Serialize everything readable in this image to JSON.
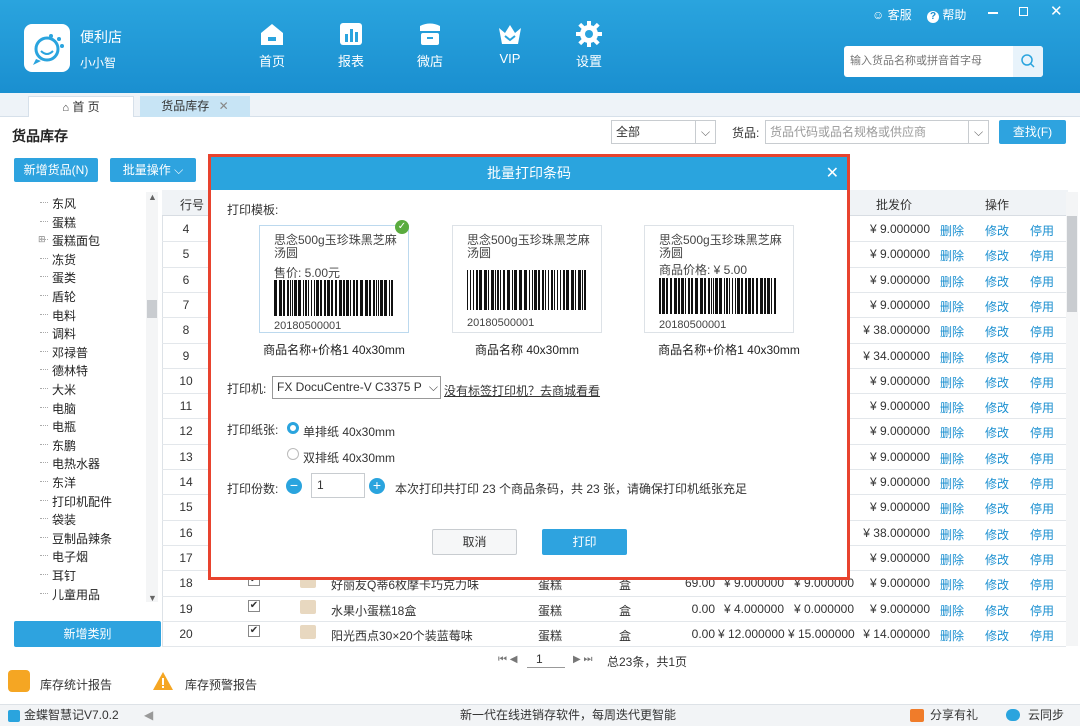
{
  "header": {
    "shop_name": "便利店",
    "user_name": "小小智",
    "nav": [
      {
        "label": "首页",
        "icon": "home-icon"
      },
      {
        "label": "报表",
        "icon": "chart-icon"
      },
      {
        "label": "微店",
        "icon": "store-icon"
      },
      {
        "label": "VIP",
        "icon": "crown-icon"
      },
      {
        "label": "设置",
        "icon": "gear-icon"
      }
    ],
    "service": "客服",
    "help": "帮助",
    "search_placeholder": "输入货品名称或拼音首字母"
  },
  "tabs": [
    {
      "label": "首 页",
      "icon": "home-icon"
    },
    {
      "label": "货品库存",
      "icon": "close-icon"
    }
  ],
  "toolbar": {
    "title": "货品库存",
    "filter_value": "全部",
    "goods_label": "货品:",
    "goods_placeholder": "货品代码或品名规格或供应商",
    "search_btn": "查找(F)",
    "add_goods": "新增货品(N)",
    "batch_ops": "批量操作"
  },
  "tree": {
    "items": [
      "东风",
      "蛋糕",
      "蛋糕面包",
      "冻货",
      "蛋类",
      "盾轮",
      "电料",
      "调料",
      "邓禄普",
      "德林特",
      "大米",
      "电脑",
      "电瓶",
      "东鹏",
      "电热水器",
      "东洋",
      "打印机配件",
      "袋装",
      "豆制品辣条",
      "电子烟",
      "耳钉",
      "儿童用品"
    ],
    "add_category": "新增类别"
  },
  "table": {
    "headers": {
      "row": "行号",
      "wholesale": "批发价",
      "ops": "操作"
    },
    "op_labels": [
      "删除",
      "修改",
      "停用"
    ],
    "visible_rows": [
      {
        "no": "4",
        "price": "¥ 9.000000"
      },
      {
        "no": "5",
        "price": "¥ 9.000000"
      },
      {
        "no": "6",
        "price": "¥ 9.000000"
      },
      {
        "no": "7",
        "price": "¥ 9.000000"
      },
      {
        "no": "8",
        "price": "¥ 38.000000"
      },
      {
        "no": "9",
        "price": "¥ 34.000000"
      },
      {
        "no": "10",
        "price": "¥ 9.000000"
      },
      {
        "no": "11",
        "price": "¥ 9.000000"
      },
      {
        "no": "12",
        "price": "¥ 9.000000"
      },
      {
        "no": "13",
        "price": "¥ 9.000000"
      },
      {
        "no": "14",
        "price": "¥ 9.000000"
      },
      {
        "no": "15",
        "price": "¥ 9.000000"
      },
      {
        "no": "16",
        "price": "¥ 38.000000"
      },
      {
        "no": "17",
        "price": "¥ 9.000000"
      }
    ],
    "full_rows": [
      {
        "no": "18",
        "name": "好丽友Q蒂6枚摩卡巧克力味",
        "cat": "蛋糕",
        "unit": "盒",
        "qty": "69.00",
        "cost": "¥ 9.000000",
        "retail": "¥ 9.000000",
        "price": "¥ 9.000000"
      },
      {
        "no": "19",
        "name": "水果小蛋糕18盒",
        "cat": "蛋糕",
        "unit": "盒",
        "qty": "0.00",
        "cost": "¥ 4.000000",
        "retail": "¥ 0.000000",
        "price": "¥ 9.000000"
      },
      {
        "no": "20",
        "name": "阳光西点30×20个装蓝莓味",
        "cat": "蛋糕",
        "unit": "盒",
        "qty": "0.00",
        "cost": "¥ 12.000000",
        "retail": "¥ 15.000000",
        "price": "¥ 14.000000"
      }
    ],
    "pager": {
      "page": "1",
      "summary": "总23条，共1页"
    }
  },
  "footer": {
    "report1": "库存统计报告",
    "report2": "库存预警报告",
    "version": "金蝶智慧记V7.0.2",
    "slogan": "新一代在线进销存软件，每周迭代更智能",
    "gift": "分享有礼",
    "sync": "云同步"
  },
  "modal": {
    "title": "批量打印条码",
    "template_label": "打印模板:",
    "templates": [
      {
        "name": "思念500g玉珍珠黑芝麻汤圆",
        "price": "售价:  5.00元",
        "code": "20180500001",
        "caption": "商品名称+价格1 40x30mm"
      },
      {
        "name": "思念500g玉珍珠黑芝麻汤圆",
        "price": "",
        "code": "20180500001",
        "caption": "商品名称 40x30mm"
      },
      {
        "name": "思念500g玉珍珠黑芝麻汤圆",
        "price": "商品价格:  ¥ 5.00",
        "code": "20180500001",
        "caption": "商品名称+价格1 40x30mm"
      }
    ],
    "printer_label": "打印机:",
    "printer_value": "FX DocuCentre-V C3375 P",
    "printer_link": "没有标签打印机？去商城看看",
    "paper_label": "打印纸张:",
    "paper_options": [
      "单排纸 40x30mm",
      "双排纸 40x30mm"
    ],
    "copies_label": "打印份数:",
    "copies_value": "1",
    "note": "本次打印共打印 23 个商品条码，共 23 张，请确保打印机纸张充足",
    "cancel": "取消",
    "print": "打印"
  }
}
